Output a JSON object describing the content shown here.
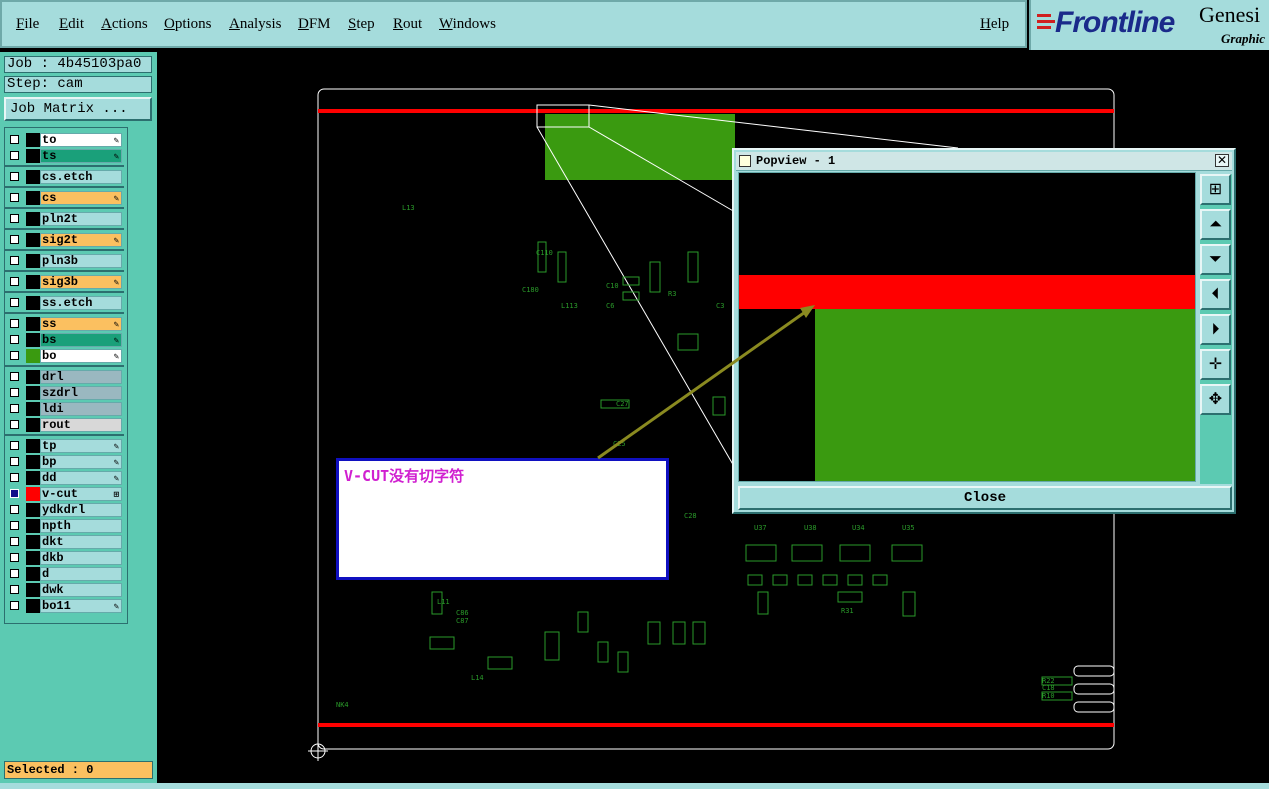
{
  "menu": {
    "items": [
      {
        "label": "File",
        "name": "menu-file"
      },
      {
        "label": "Edit",
        "name": "menu-edit"
      },
      {
        "label": "Actions",
        "name": "menu-actions"
      },
      {
        "label": "Options",
        "name": "menu-options"
      },
      {
        "label": "Analysis",
        "name": "menu-analysis"
      },
      {
        "label": "DFM",
        "name": "menu-dfm"
      },
      {
        "label": "Step",
        "name": "menu-step"
      },
      {
        "label": "Rout",
        "name": "menu-rout"
      },
      {
        "label": "Windows",
        "name": "menu-windows"
      }
    ],
    "help": "Help"
  },
  "logo": {
    "brand": "Frontline",
    "product": "Genesi",
    "sub": "Graphic"
  },
  "job": {
    "job_label": "Job : 4b45103pa0",
    "step_label": "Step: cam",
    "matrix_button": "Job Matrix ..."
  },
  "layers": [
    {
      "name": "to",
      "color": "#ffffff",
      "swatch": "#000000",
      "mark": "✎"
    },
    {
      "name": "ts",
      "color": "#1aa07a",
      "swatch": "#000000",
      "mark": "✎"
    },
    {
      "name": "cs.etch",
      "color": "#a5dcdc",
      "swatch": "#000000",
      "mark": ""
    },
    {
      "name": "cs",
      "color": "#fbc060",
      "swatch": "#000000",
      "mark": "✎"
    },
    {
      "name": "pln2t",
      "color": "#a5dcdc",
      "swatch": "#000000",
      "mark": ""
    },
    {
      "name": "sig2t",
      "color": "#fbc060",
      "swatch": "#000000",
      "mark": "✎"
    },
    {
      "name": "pln3b",
      "color": "#a5dcdc",
      "swatch": "#000000",
      "mark": ""
    },
    {
      "name": "sig3b",
      "color": "#fbc060",
      "swatch": "#000000",
      "mark": "✎"
    },
    {
      "name": "ss.etch",
      "color": "#a5dcdc",
      "swatch": "#000000",
      "mark": ""
    },
    {
      "name": "ss",
      "color": "#fbc060",
      "swatch": "#000000",
      "mark": "✎"
    },
    {
      "name": "bs",
      "color": "#1aa07a",
      "swatch": "#000000",
      "mark": "✎"
    },
    {
      "name": "bo",
      "color": "#ffffff",
      "swatch": "#3a9a10",
      "mark": "✎"
    },
    {
      "name": "drl",
      "color": "#9ab8c0",
      "swatch": "#000000",
      "mark": ""
    },
    {
      "name": "szdrl",
      "color": "#9ab8c0",
      "swatch": "#000000",
      "mark": ""
    },
    {
      "name": "ldi",
      "color": "#9ab8c0",
      "swatch": "#000000",
      "mark": ""
    },
    {
      "name": "rout",
      "color": "#d8d8d8",
      "swatch": "#000000",
      "mark": ""
    },
    {
      "name": "tp",
      "color": "#a5dcdc",
      "swatch": "#000000",
      "mark": "✎"
    },
    {
      "name": "bp",
      "color": "#a5dcdc",
      "swatch": "#000000",
      "mark": "✎"
    },
    {
      "name": "dd",
      "color": "#a5dcdc",
      "swatch": "#000000",
      "mark": "✎"
    },
    {
      "name": "v-cut",
      "color": "#a5dcdc",
      "swatch": "#ff0000",
      "mark": "⊞"
    },
    {
      "name": "ydkdrl",
      "color": "#a5dcdc",
      "swatch": "#000000",
      "mark": ""
    },
    {
      "name": "npth",
      "color": "#a5dcdc",
      "swatch": "#000000",
      "mark": ""
    },
    {
      "name": "dkt",
      "color": "#a5dcdc",
      "swatch": "#000000",
      "mark": ""
    },
    {
      "name": "dkb",
      "color": "#a5dcdc",
      "swatch": "#000000",
      "mark": ""
    },
    {
      "name": "d",
      "color": "#a5dcdc",
      "swatch": "#000000",
      "mark": ""
    },
    {
      "name": "dwk",
      "color": "#a5dcdc",
      "swatch": "#000000",
      "mark": ""
    },
    {
      "name": "bo11",
      "color": "#a5dcdc",
      "swatch": "#000000",
      "mark": "✎"
    }
  ],
  "status": {
    "selected": "Selected : 0"
  },
  "popview": {
    "title": "Popview - 1",
    "close_button": "Close",
    "close_x": "✕"
  },
  "annotation": {
    "text": "V-CUT没有切字符"
  },
  "board_labels": [
    "L13",
    "C110",
    "C180",
    "L113",
    "C10",
    "C6",
    "R3",
    "C3",
    "U37",
    "U38",
    "U34",
    "U35",
    "L14",
    "R31",
    "R10",
    "R22",
    "C18",
    "NK4",
    "C86",
    "C87",
    "L11",
    "C28",
    "C27",
    "C25"
  ],
  "colors": {
    "panel": "#a5dcdc",
    "accent": "#5ccab2",
    "vcut": "#ff0000",
    "copper": "#3a9a10",
    "annotation_text": "#d020d0",
    "annotation_border": "#1010c0"
  }
}
